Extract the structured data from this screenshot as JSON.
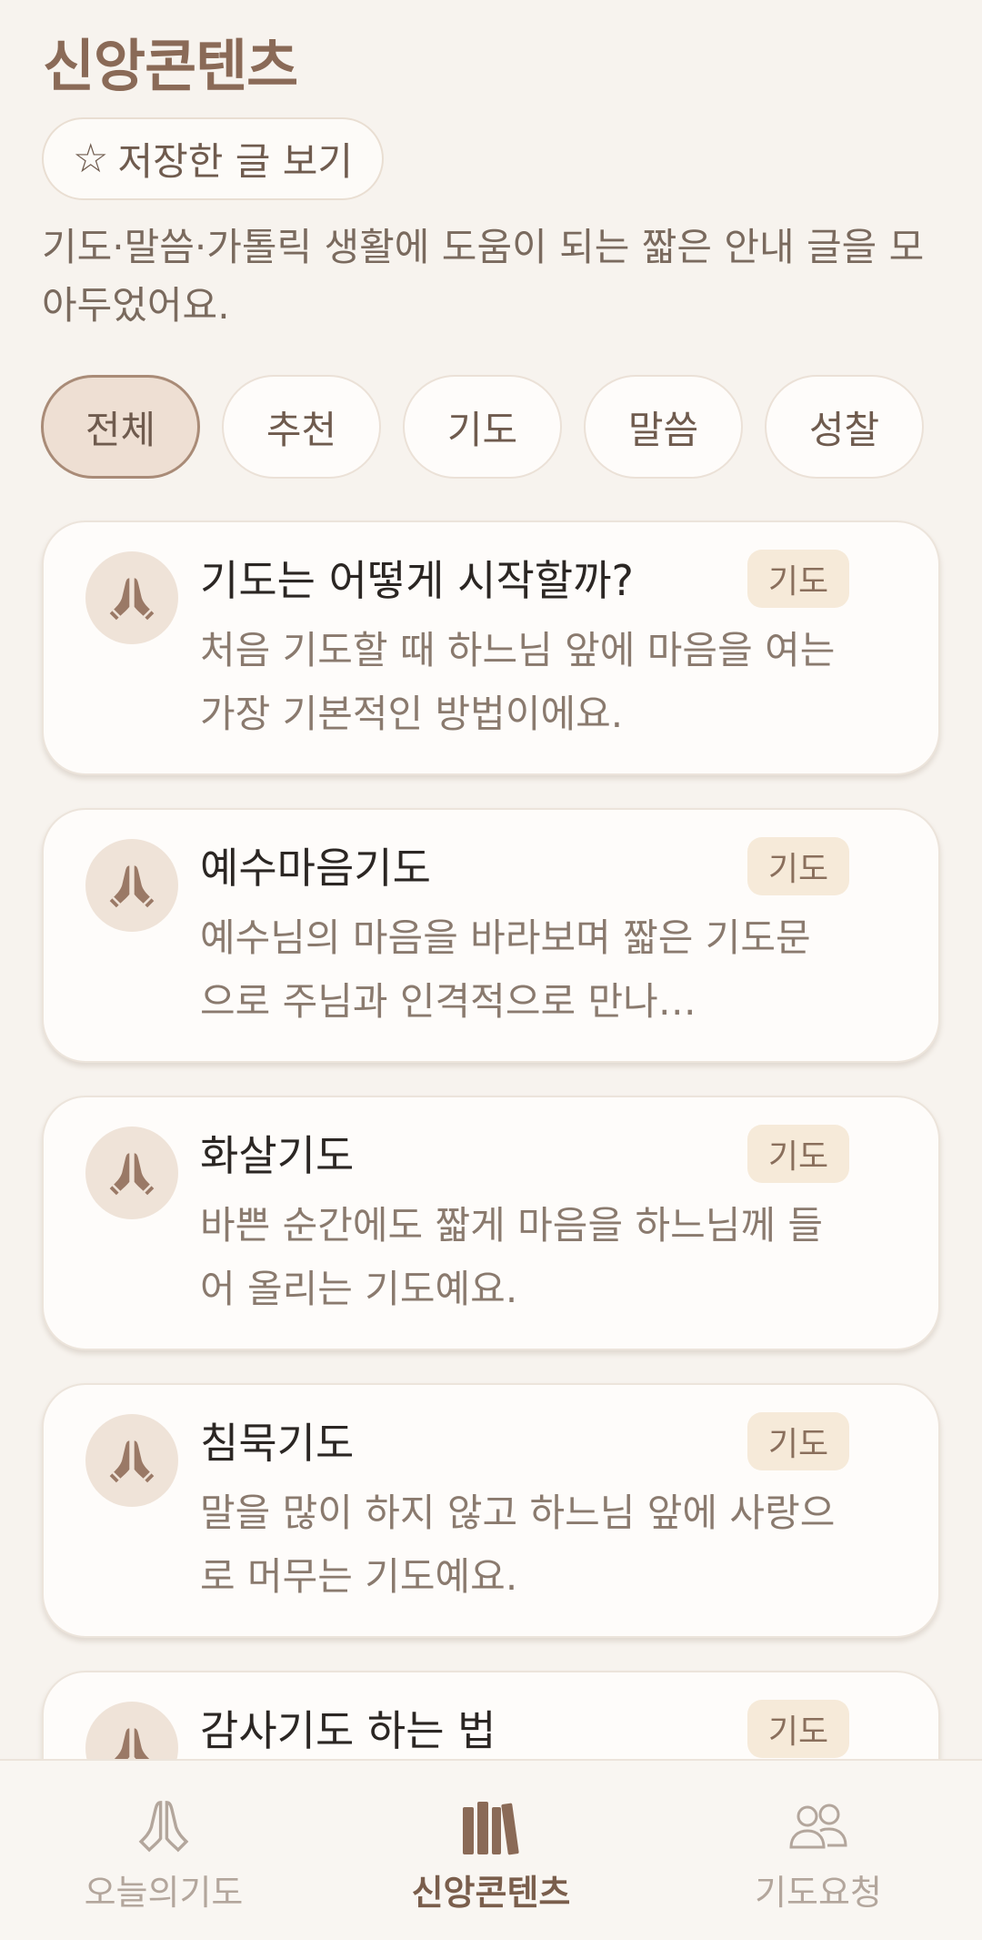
{
  "header": {
    "title": "신앙콘텐츠",
    "saved_button_label": "저장한 글 보기",
    "description": "기도·말씀·가톨릭 생활에 도움이 되는 짧은 안내 글을 모아두었어요."
  },
  "filters": [
    {
      "label": "전체",
      "active": true
    },
    {
      "label": "추천",
      "active": false
    },
    {
      "label": "기도",
      "active": false
    },
    {
      "label": "말씀",
      "active": false
    },
    {
      "label": "성찰",
      "active": false
    }
  ],
  "cards": [
    {
      "title": "기도는 어떻게 시작할까?",
      "tag": "기도",
      "icon": "praying-hands-icon",
      "body": "처음 기도할 때 하느님 앞에 마음을 여는 가장 기본적인 방법이에요."
    },
    {
      "title": "예수마음기도",
      "tag": "기도",
      "icon": "praying-hands-icon",
      "body": "예수님의 마음을 바라보며 짧은 기도문으로 주님과 인격적으로 만나…"
    },
    {
      "title": "화살기도",
      "tag": "기도",
      "icon": "praying-hands-icon",
      "body": "바쁜 순간에도 짧게 마음을 하느님께 들어 올리는 기도예요."
    },
    {
      "title": "침묵기도",
      "tag": "기도",
      "icon": "praying-hands-icon",
      "body": "말을 많이 하지 않고 하느님 앞에 사랑으로 머무는 기도예요."
    },
    {
      "title": "감사기도 하는 법",
      "tag": "기도",
      "icon": "praying-hands-icon",
      "body": ""
    }
  ],
  "nav": {
    "items": [
      {
        "label": "오늘의기도",
        "icon": "praying-hands-icon",
        "active": false
      },
      {
        "label": "신앙콘텐츠",
        "icon": "books-icon",
        "active": true
      },
      {
        "label": "기도요청",
        "icon": "people-icon",
        "active": false
      }
    ]
  },
  "colors": {
    "background": "#f7f3ee",
    "accent": "#8a6a57",
    "active_chip_bg": "#eedfd3",
    "tag_bg": "#f6ead9"
  }
}
